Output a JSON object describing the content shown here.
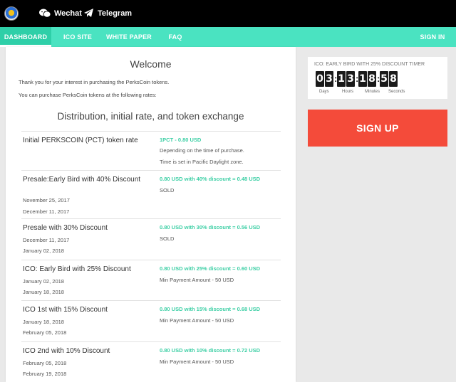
{
  "topbar": {
    "wechat_label": "Wechat",
    "telegram_label": "Telegram",
    "colors": {
      "background": "#000000"
    }
  },
  "nav": {
    "items": [
      "DASHBOARD",
      "ICO SITE",
      "WHITE PAPER",
      "FAQ"
    ],
    "active": "DASHBOARD",
    "signin_label": "SIGN IN",
    "colors": {
      "bar": "#4ae3c1",
      "active": "#2ecfa8"
    }
  },
  "main": {
    "title": "Welcome",
    "intro_1": "Thank you for your interest in purchasing the PerksCoin tokens.",
    "intro_2": "You can purchase PerksCoin tokens at the following rates:",
    "distribution_title": "Distribution, initial rate, and token exchange",
    "rows": [
      {
        "name": "Initial PERKSCOIN (PCT) token rate",
        "dates": [],
        "price": "1PCT - 0.80 USD",
        "notes": [
          "Depending on the time of purchase.",
          "Time is set in Pacific Daylight zone."
        ]
      },
      {
        "name": "Presale:Early Bird with 40% Discount",
        "dates": [
          "November 25, 2017",
          "December 11, 2017"
        ],
        "price": "0.80 USD with 40% discount = 0.48 USD",
        "notes": [
          "SOLD"
        ]
      },
      {
        "name": "Presale with 30% Discount",
        "dates": [
          "December 11, 2017",
          "January 02, 2018"
        ],
        "price": "0.80 USD with 30% discount = 0.56 USD",
        "notes": [
          "SOLD"
        ]
      },
      {
        "name": "ICO: Early Bird with 25% Discount",
        "dates": [
          "January 02, 2018",
          "January 18, 2018"
        ],
        "price": "0.80 USD with 25% discount = 0.60 USD",
        "notes": [
          "Min Payment Amount - 50 USD"
        ]
      },
      {
        "name": "ICO 1st with 15% Discount",
        "dates": [
          "January 18, 2018",
          "February 05, 2018"
        ],
        "price": "0.80 USD with 15% discount = 0.68 USD",
        "notes": [
          "Min Payment Amount - 50 USD"
        ]
      },
      {
        "name": "ICO 2nd with 10% Discount",
        "dates": [
          "February 05, 2018",
          "February 19, 2018"
        ],
        "price": "0.80 USD with 10% discount = 0.72 USD",
        "notes": [
          "Min Payment Amount - 50 USD"
        ]
      }
    ],
    "colors": {
      "price": "#3dcfa5"
    }
  },
  "timer": {
    "title": "ICO: EARLY BIRD WITH 25% DISCOUNT TIMER",
    "days": "03",
    "hours": "13",
    "minutes": "18",
    "seconds": "58",
    "units": [
      "Days",
      "Hours",
      "Minutes",
      "Seconds"
    ]
  },
  "signup": {
    "label": "SIGN UP",
    "colors": {
      "background": "#f44b3a"
    }
  }
}
